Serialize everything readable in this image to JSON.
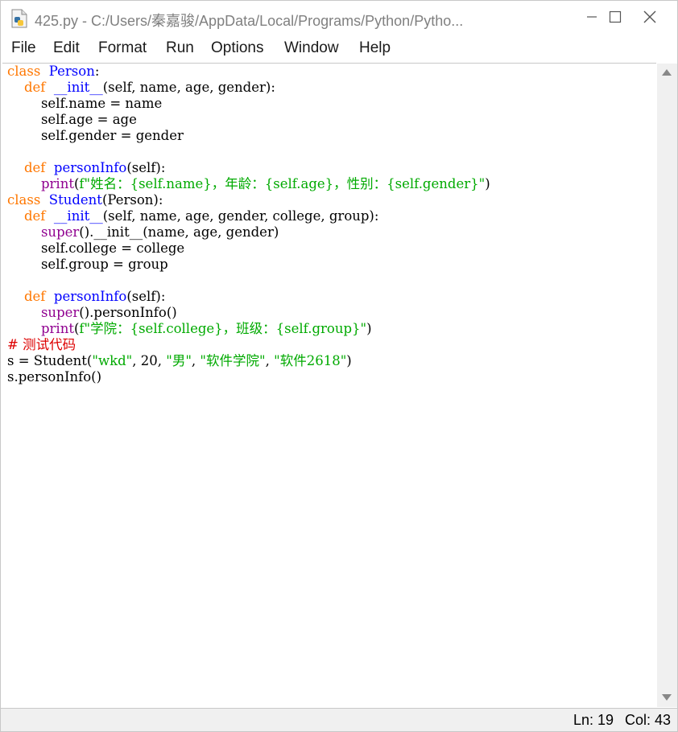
{
  "window": {
    "title": "425.py - C:/Users/秦嘉骏/AppData/Local/Programs/Python/Pytho...",
    "icon": "python-file-icon",
    "controls": {
      "minimize_icon": "minimize-icon",
      "maximize_icon": "maximize-icon",
      "close_icon": "close-icon"
    }
  },
  "menubar": {
    "items": [
      "File",
      "Edit",
      "Format",
      "Run",
      "Options",
      "Window",
      "Help"
    ]
  },
  "editor": {
    "colors": {
      "keyword": "#ff7700",
      "definition": "#0000ff",
      "builtin": "#900090",
      "string": "#00aa00",
      "comment": "#dd0000",
      "default": "#000000"
    },
    "lines": [
      [
        [
          "kw",
          "class"
        ],
        [
          "",
          "  "
        ],
        [
          "def",
          "Person"
        ],
        [
          "",
          ":"
        ]
      ],
      [
        [
          "",
          "    "
        ],
        [
          "kw",
          "def"
        ],
        [
          "",
          "  "
        ],
        [
          "def",
          "__init__"
        ],
        [
          "",
          "(self, name, age, gender):"
        ]
      ],
      [
        [
          "",
          "        self.name = name"
        ]
      ],
      [
        [
          "",
          "        self.age = age"
        ]
      ],
      [
        [
          "",
          "        self.gender = gender"
        ]
      ],
      [],
      [
        [
          "",
          "    "
        ],
        [
          "kw",
          "def"
        ],
        [
          "",
          "  "
        ],
        [
          "def",
          "personInfo"
        ],
        [
          "",
          "(self):"
        ]
      ],
      [
        [
          "",
          "        "
        ],
        [
          "bi",
          "print"
        ],
        [
          "",
          "("
        ],
        [
          "str",
          "f\"姓名：{self.name}，年龄：{self.age}，性别：{self.gender}\""
        ],
        [
          "",
          ")"
        ]
      ],
      [
        [
          "kw",
          "class"
        ],
        [
          "",
          "  "
        ],
        [
          "def",
          "Student"
        ],
        [
          "",
          "(Person):"
        ]
      ],
      [
        [
          "",
          "    "
        ],
        [
          "kw",
          "def"
        ],
        [
          "",
          "  "
        ],
        [
          "def",
          "__init__"
        ],
        [
          "",
          "(self, name, age, gender, college, group):"
        ]
      ],
      [
        [
          "",
          "        "
        ],
        [
          "bi",
          "super"
        ],
        [
          "",
          "().__init__(name, age, gender)"
        ]
      ],
      [
        [
          "",
          "        self.college = college"
        ]
      ],
      [
        [
          "",
          "        self.group = group"
        ]
      ],
      [],
      [
        [
          "",
          "    "
        ],
        [
          "kw",
          "def"
        ],
        [
          "",
          "  "
        ],
        [
          "def",
          "personInfo"
        ],
        [
          "",
          "(self):"
        ]
      ],
      [
        [
          "",
          "        "
        ],
        [
          "bi",
          "super"
        ],
        [
          "",
          "().personInfo()"
        ]
      ],
      [
        [
          "",
          "        "
        ],
        [
          "bi",
          "print"
        ],
        [
          "",
          "("
        ],
        [
          "str",
          "f\"学院：{self.college}，班级：{self.group}\""
        ],
        [
          "",
          ")"
        ]
      ],
      [
        [
          "cmt",
          "# 测试代码"
        ]
      ],
      [
        [
          "",
          "s = Student("
        ],
        [
          "str",
          "\"wkd\""
        ],
        [
          "",
          ", 20, "
        ],
        [
          "str",
          "\"男\""
        ],
        [
          "",
          ", "
        ],
        [
          "str",
          "\"软件学院\""
        ],
        [
          "",
          ", "
        ],
        [
          "str",
          "\"软件2618\""
        ],
        [
          "",
          ")"
        ]
      ],
      [
        [
          "",
          "s.personInfo()"
        ]
      ]
    ]
  },
  "scrollbar": {
    "up_icon": "scroll-up-arrow-icon",
    "down_icon": "scroll-down-arrow-icon"
  },
  "statusbar": {
    "line": "Ln: 19",
    "col": "Col: 43"
  }
}
